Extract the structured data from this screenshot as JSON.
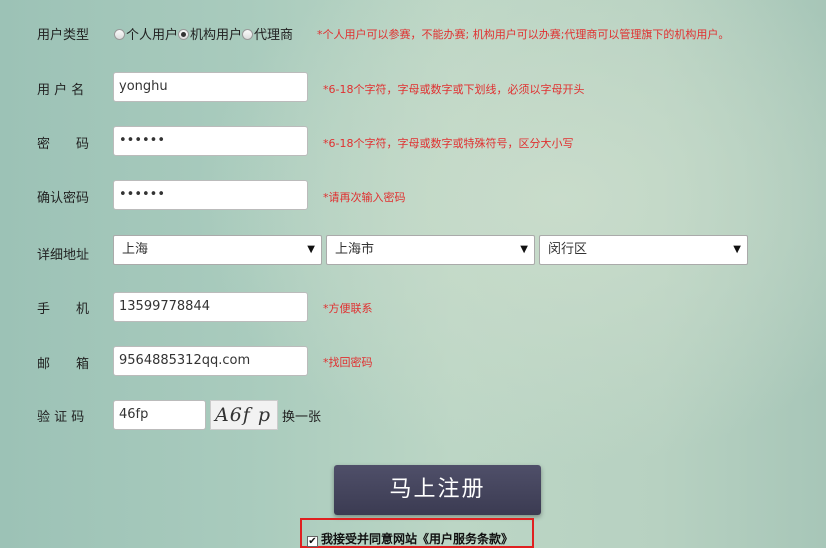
{
  "user_type": {
    "label": "用户类型",
    "options": [
      "个人用户",
      "机构用户",
      "代理商"
    ],
    "selected": "机构用户",
    "hint": "*个人用户可以参赛，不能办赛; 机构用户可以办赛;代理商可以管理旗下的机构用户。"
  },
  "username": {
    "label": "用 户 名",
    "value": "yonghu",
    "hint": "*6-18个字符，字母或数字或下划线，必须以字母开头"
  },
  "password": {
    "label": "密　　码",
    "value": "••••••",
    "hint": "*6-18个字符，字母或数字或特殊符号，区分大小写"
  },
  "confirm": {
    "label": "确认密码",
    "value": "••••••",
    "hint": "*请再次输入密码"
  },
  "address": {
    "label": "详细地址",
    "province": "上海",
    "city": "上海市",
    "district": "闵行区"
  },
  "phone": {
    "label": "手　　机",
    "value": "13599778844",
    "hint": "*方便联系"
  },
  "email": {
    "label": "邮　　箱",
    "value": "9564885312qq.com",
    "hint": "*找回密码"
  },
  "captcha": {
    "label": "验 证 码",
    "value": "46fp",
    "image_text": "A6f p",
    "refresh_label": "换一张"
  },
  "submit_label": "马上注册",
  "agreement": {
    "checked": true,
    "text": "我接受并同意网站《用户服务条款》"
  }
}
